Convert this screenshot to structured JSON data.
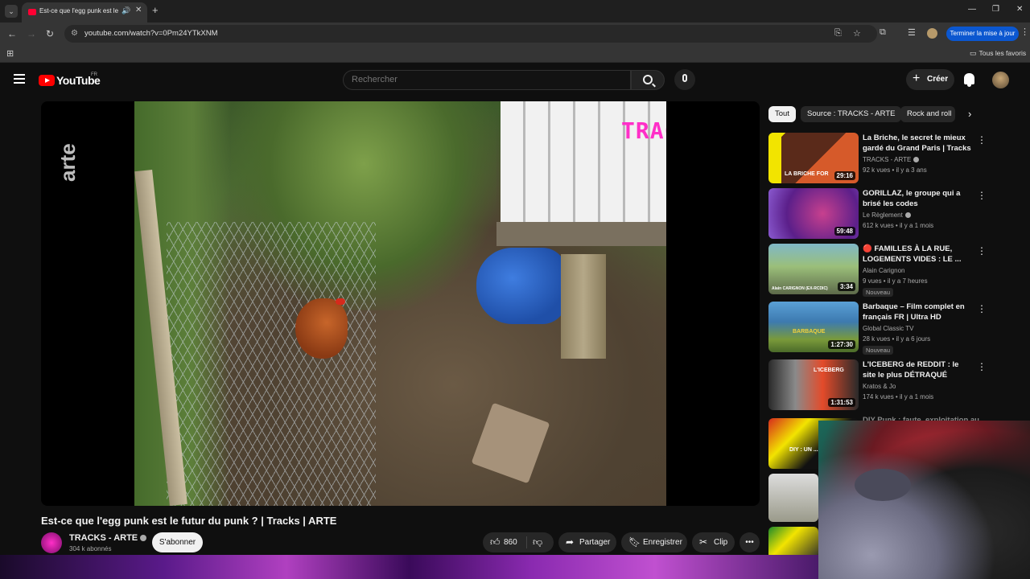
{
  "browser": {
    "tab_title": "Est-ce que l'egg punk est le futur du punk ? | Tracks | ARTE",
    "url": "youtube.com/watch?v=0Pm24YTkXNM",
    "update_button_label": "Terminer la mise à jour",
    "all_bookmarks_label": "Tous les favoris",
    "icons": [
      "back-icon",
      "forward-icon",
      "reload-icon",
      "site-info-icon",
      "install-icon",
      "star-icon",
      "extensions-icon",
      "reading-list-icon",
      "apps-icon",
      "folder-icon"
    ]
  },
  "masthead": {
    "logo_text": "YouTube",
    "country_code": "FR",
    "search_placeholder": "Rechercher",
    "create_label": "Créer"
  },
  "player": {
    "overlay_logo": "TRACKS",
    "channel_watermark": "arte"
  },
  "video": {
    "title": "Est-ce que l'egg punk est le futur du punk ? | Tracks | ARTE",
    "channel_name": "TRACKS - ARTE",
    "subscriber_count": "304 k abonnés",
    "subscribe_label": "S'abonner",
    "like_count": "860",
    "share_label": "Partager",
    "save_label": "Enregistrer",
    "clip_label": "Clip",
    "more_label": "•••"
  },
  "chips": {
    "items": [
      "Tout",
      "Source : TRACKS - ARTE",
      "Rock and roll"
    ],
    "selected": "Tout"
  },
  "recommendations": [
    {
      "title": "La Briche, le secret le mieux gardé du Grand Paris | Tracks |...",
      "channel": "TRACKS - ARTE",
      "verified": true,
      "meta": "92 k vues • il y a 3 ans",
      "duration": "29:16",
      "thumb_text": "LA BRICHE FOR",
      "badge": ""
    },
    {
      "title": "GORILLAZ, le groupe qui a brisé les codes",
      "channel": "Le Règlement",
      "verified": true,
      "meta": "612 k vues • il y a 1 mois",
      "duration": "59:48",
      "thumb_text": "",
      "badge": ""
    },
    {
      "title": "🔴 FAMILLES À LA RUE, LOGEMENTS VIDES : LE ...",
      "channel": "Alain Carignon",
      "verified": false,
      "meta": "9 vues • il y a 7 heures",
      "duration": "3:34",
      "thumb_text": "Alain CARIGNON (EX-RCDIC)",
      "badge": "Nouveau"
    },
    {
      "title": "Barbaque – Film complet en français FR | Ultra HD",
      "channel": "Global Classic TV",
      "verified": false,
      "meta": "28 k vues • il y a 6 jours",
      "duration": "1:27:30",
      "thumb_text": "BARBAQUE",
      "badge": "Nouveau"
    },
    {
      "title": "L'ICEBERG de REDDIT : le site le plus DÉTRAQUÉ d'internet...",
      "channel": "Kratos & Jo",
      "verified": false,
      "meta": "174 k vues • il y a 1 mois",
      "duration": "1:31:53",
      "thumb_text": "L'ICEBERG",
      "badge": ""
    }
  ],
  "partial_recommendation": {
    "title": "DIY Punk : faute, exploitation au...",
    "thumb_text": "DIY : UN ... DE RÉSI..."
  },
  "colors": {
    "yt_red": "#ff0000",
    "tracks_magenta": "#ff2fc8",
    "chrome_blue": "#0b57d0",
    "background": "#0f0f0f"
  }
}
